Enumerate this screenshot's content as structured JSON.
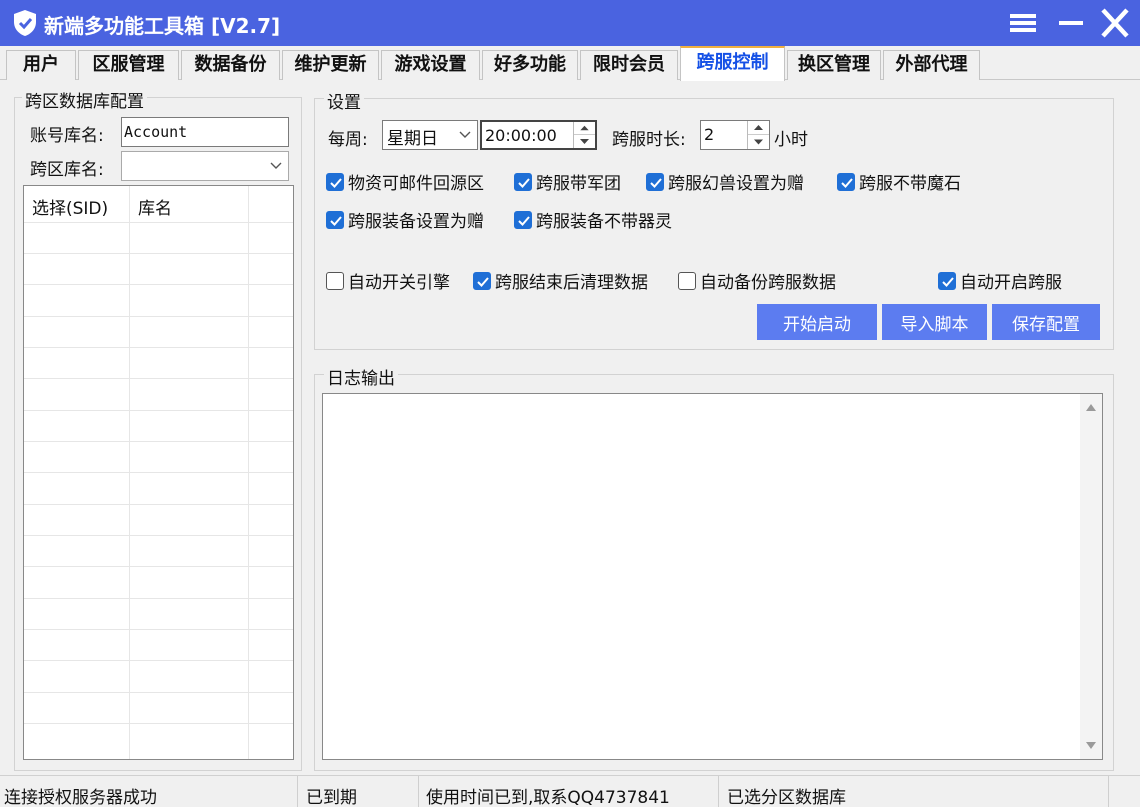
{
  "window": {
    "title": "新端多功能工具箱 [V2.7]"
  },
  "tabs": [
    "用户",
    "区服管理",
    "数据备份",
    "维护更新",
    "游戏设置",
    "好多功能",
    "限时会员",
    "跨服控制",
    "换区管理",
    "外部代理"
  ],
  "active_tab": "跨服控制",
  "left_panel": {
    "legend": "跨区数据库配置",
    "account_db_label": "账号库名:",
    "account_db_value": "Account",
    "cross_db_label": "跨区库名:",
    "cross_db_value": "",
    "grid_headers": [
      "选择(SID)",
      "库名"
    ]
  },
  "settings": {
    "legend": "设置",
    "weekly_label": "每周:",
    "weekday_value": "星期日",
    "time_value": "20:00:00",
    "duration_label": "跨服时长:",
    "duration_value": "2",
    "duration_unit": "小时",
    "checkboxes": [
      {
        "label": "物资可邮件回源区",
        "checked": true
      },
      {
        "label": "跨服带军团",
        "checked": true
      },
      {
        "label": "跨服幻兽设置为赠",
        "checked": true
      },
      {
        "label": "跨服不带魔石",
        "checked": true
      },
      {
        "label": "跨服装备设置为赠",
        "checked": true
      },
      {
        "label": "跨服装备不带器灵",
        "checked": true
      },
      {
        "label": "自动开关引擎",
        "checked": false
      },
      {
        "label": "跨服结束后清理数据",
        "checked": true
      },
      {
        "label": "自动备份跨服数据",
        "checked": false
      },
      {
        "label": "自动开启跨服",
        "checked": true
      }
    ],
    "buttons": {
      "start": "开始启动",
      "import": "导入脚本",
      "save": "保存配置"
    }
  },
  "log": {
    "legend": "日志输出"
  },
  "statusbar": {
    "connection": "连接授权服务器成功",
    "expiry": "已到期",
    "usage": "使用时间已到,取系QQ4737841",
    "db_selected": "已选分区数据库"
  },
  "colors": {
    "titlebar": "#4a63e0",
    "button": "#5c7cf0",
    "checkbox": "#1f6fd6",
    "active_tab_text": "#1450e6"
  }
}
